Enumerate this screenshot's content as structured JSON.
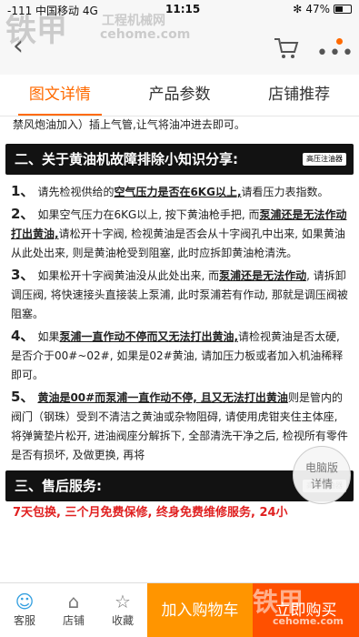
{
  "status_bar": {
    "carrier": "-111 中国移动  4G",
    "time": "11:15",
    "battery": "47%"
  },
  "nav": {
    "back_icon": "chevron-left-icon",
    "cart_icon": "cart-icon",
    "more_icon": "more-icon"
  },
  "tabs": [
    {
      "label": "图文详情",
      "active": true
    },
    {
      "label": "产品参数",
      "active": false
    },
    {
      "label": "店铺推荐",
      "active": false
    }
  ],
  "content": {
    "pre_text": "禁风炮油加入）插上气管,让气将油冲进去即可。",
    "section2_title": "二、关于黄油机故障排除小知识分享:",
    "section_brand": "高压注油器",
    "items": [
      {
        "num": "1、",
        "pre": "请先检视供给的",
        "hl": "空气压力是否在6KG以上,",
        "post": "请看压力表指数。"
      },
      {
        "num": "2、",
        "pre": "如果空气压力在6KG以上, 按下黄油枪手把, 而",
        "hl": "泵浦还是无法作动打出黄油,",
        "post": "请松开十字阀, 检视黄油是否会从十字阀孔中出来, 如果黄油从此处出来, 则是黄油枪受到阻塞, 此时应拆卸黄油枪清洗。"
      },
      {
        "num": "3、",
        "pre": "如果松开十字阀黄油没从此处出来, 而",
        "hl": "泵浦还是无法作动",
        "post": ", 请拆卸调压阀, 将快速接头直接装上泵浦, 此时泵浦若有作动, 那就是调压阀被阻塞。"
      },
      {
        "num": "4、",
        "pre": "如果",
        "hl": "泵浦一直作动不停而又无法打出黄油,",
        "post": "请检视黄油是否太硬, 是否介于00#~02#, 如果是02#黄油, 请加压力板或者加入机油稀释即可。"
      },
      {
        "num": "5、",
        "pre": "",
        "hl": "黄油是00#而泵浦一直作动不停, 且又无法打出黄油",
        "post": "则是管内的阀门（钢珠）受到不清洁之黄油或杂物阻碍, 请使用虎钳夹住主体座, 将弹簧垫片松开, 进油阀座分解拆下, 全部清洗干净之后, 检视所有零件是否有损坏, 及做更换, 再将"
      }
    ],
    "section3_title": "三、售后服务:",
    "warranty_text": "7天包换, 三个月免费保修, 终身免费维修服务, 24小"
  },
  "pc_badge": {
    "line1": "电脑版",
    "line2": "详情"
  },
  "bottom_bar": {
    "service_label": "客服",
    "shop_label": "店铺",
    "favorite_label": "收藏",
    "add_cart_label": "加入购物车",
    "buy_now_label": "立即购买"
  },
  "watermarks": {
    "top_logo": "铁甲",
    "top_text": "工程机械网",
    "top_url": "cehome.com",
    "bottom_logo": "铁甲",
    "bottom_url": "cehome.com"
  },
  "colors": {
    "accent": "#ff6a00",
    "add_cart": "#ff9500",
    "buy_now": "#ff5000",
    "banner": "#121212",
    "warranty": "#e02020"
  }
}
